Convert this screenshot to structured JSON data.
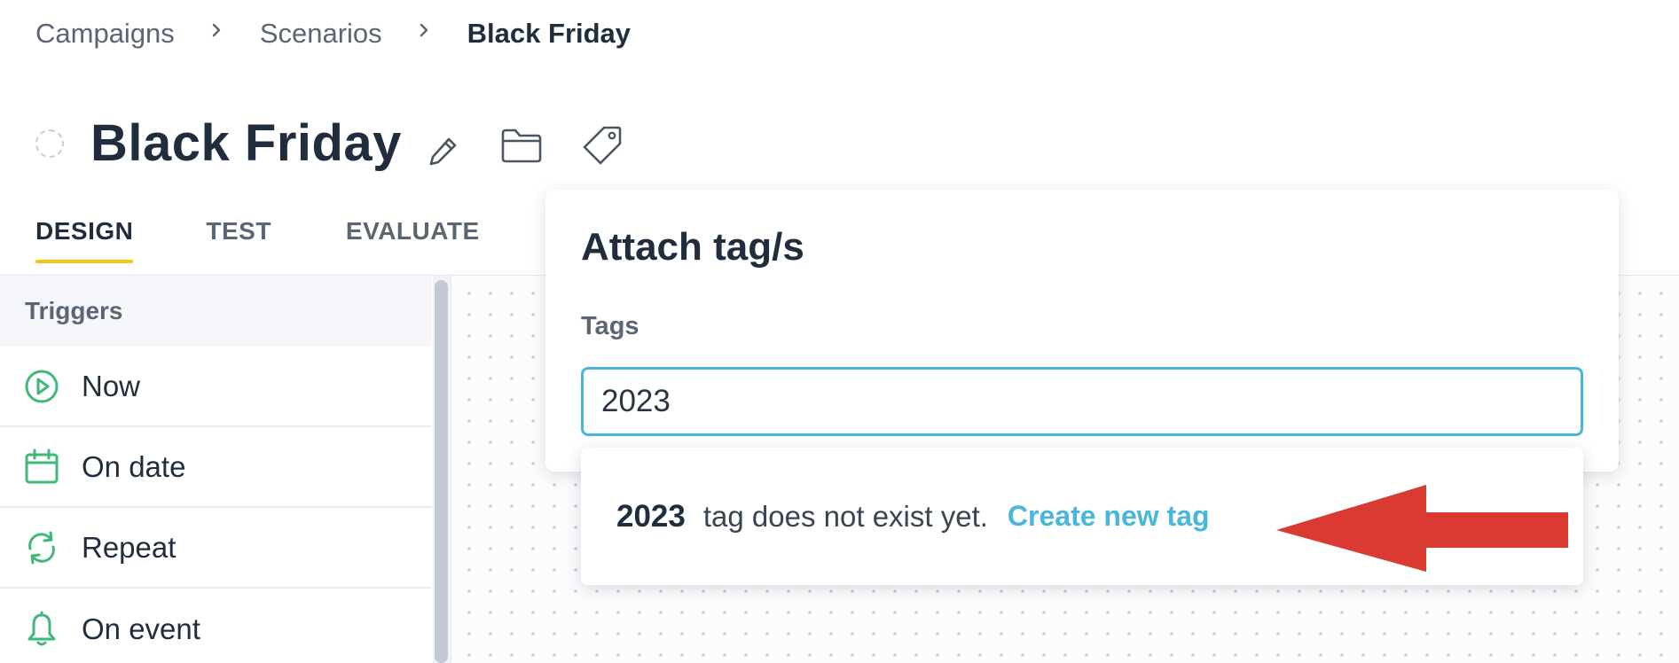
{
  "breadcrumb": {
    "items": [
      {
        "label": "Campaigns"
      },
      {
        "label": "Scenarios"
      },
      {
        "label": "Black Friday"
      }
    ]
  },
  "header": {
    "title": "Black Friday",
    "icons": [
      "circle-status-icon",
      "pencil-icon",
      "folder-icon",
      "tag-icon"
    ]
  },
  "tabs": [
    {
      "label": "DESIGN",
      "active": true
    },
    {
      "label": "TEST",
      "active": false
    },
    {
      "label": "EVALUATE",
      "active": false
    }
  ],
  "sidebar": {
    "section_title": "Triggers",
    "items": [
      {
        "label": "Now",
        "icon": "play-circle-icon"
      },
      {
        "label": "On date",
        "icon": "calendar-icon"
      },
      {
        "label": "Repeat",
        "icon": "repeat-icon"
      },
      {
        "label": "On event",
        "icon": "bell-icon"
      }
    ]
  },
  "tag_popup": {
    "title": "Attach tag/s",
    "field_label": "Tags",
    "input_value": "2023"
  },
  "tag_dropdown": {
    "value": "2023",
    "message": "tag does not exist yet.",
    "create_label": "Create new tag"
  },
  "annotation": {
    "icon": "red-arrow-icon",
    "color": "#d93a32"
  },
  "colors": {
    "accent": "#49b6dc",
    "tab_underline": "#f5c518",
    "trigger_icon": "#3fb97a",
    "text_primary": "#1f2d3d",
    "text_secondary": "#5b6573"
  }
}
